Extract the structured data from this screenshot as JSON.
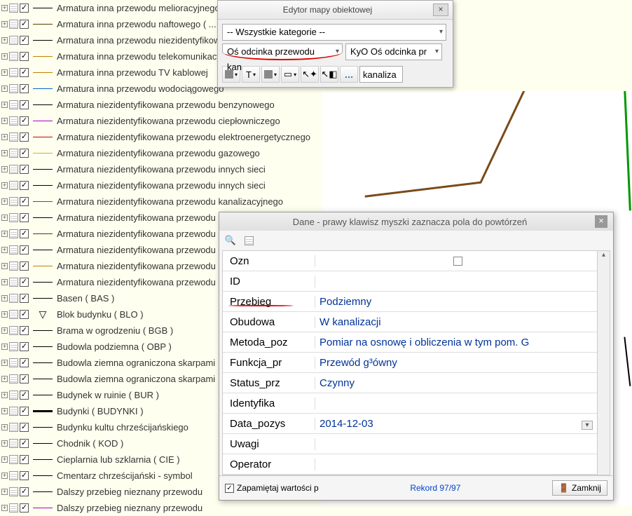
{
  "tree": {
    "items": [
      {
        "label": "Armatura inna przewodu melioracyjnego ( ... )",
        "color": "#000"
      },
      {
        "label": "Armatura inna przewodu naftowego ( ... )",
        "color": "#5a3a00"
      },
      {
        "label": "Armatura inna przewodu niezidentyfikowanego",
        "color": "#000"
      },
      {
        "label": "Armatura inna przewodu telekomunikacyjnego",
        "color": "#c08000"
      },
      {
        "label": "Armatura inna przewodu TV kablowej",
        "color": "#c08000"
      },
      {
        "label": "Armatura inna przewodu wodociągowego",
        "color": "#0066cc"
      },
      {
        "label": "Armatura niezidentyfikowana przewodu benzynowego",
        "color": "#000"
      },
      {
        "label": "Armatura niezidentyfikowana przewodu ciepłowniczego",
        "color": "#aa00cc"
      },
      {
        "label": "Armatura niezidentyfikowana przewodu elektroenergetycznego",
        "color": "#cc0000"
      },
      {
        "label": "Armatura niezidentyfikowana przewodu gazowego",
        "color": "#ccbb00"
      },
      {
        "label": "Armatura niezidentyfikowana przewodu innych sieci",
        "color": "#000"
      },
      {
        "label": "Armatura niezidentyfikowana przewodu innych sieci",
        "color": "#000"
      },
      {
        "label": "Armatura niezidentyfikowana przewodu kanalizacyjnego",
        "color": "#7a4a1a"
      },
      {
        "label": "Armatura niezidentyfikowana przewodu melioracyjnego",
        "color": "#000"
      },
      {
        "label": "Armatura niezidentyfikowana przewodu",
        "color": "#5a3a00"
      },
      {
        "label": "Armatura niezidentyfikowana przewodu",
        "color": "#000"
      },
      {
        "label": "Armatura niezidentyfikowana przewodu",
        "color": "#c08000"
      },
      {
        "label": "Armatura niezidentyfikowana przewodu",
        "color": "#000"
      },
      {
        "label": "Basen ( BAS )",
        "color": "#000"
      },
      {
        "label": "Blok budynku ( BLO )",
        "symbol": "▽"
      },
      {
        "label": "Brama w ogrodzeniu ( BGB )",
        "color": "#000"
      },
      {
        "label": "Budowla podziemna ( OBP )",
        "color": "#000"
      },
      {
        "label": "Budowla ziemna ograniczona skarpami",
        "color": "#000"
      },
      {
        "label": "Budowla ziemna ograniczona skarpami",
        "color": "#000"
      },
      {
        "label": "Budynek w ruinie ( BUR )",
        "color": "#000"
      },
      {
        "label": "Budynki ( BUDYNKI )",
        "color": "#000",
        "thick": true
      },
      {
        "label": "Budynku kultu chrześcijańskiego",
        "color": "#000"
      },
      {
        "label": "Chodnik ( KOD )",
        "color": "#000"
      },
      {
        "label": "Cieplarnia lub szklarnia ( CIE )",
        "color": "#000"
      },
      {
        "label": "Cmentarz chrześcijański - symbol",
        "color": "#000"
      },
      {
        "label": "Dalszy przebieg nieznany przewodu",
        "color": "#000"
      },
      {
        "label": "Dalszy przebieg nieznany przewodu",
        "color": "#aa00cc"
      }
    ]
  },
  "editor": {
    "title": "Edytor mapy obiektowej",
    "category": "-- Wszystkie kategorie --",
    "combo1": "Oś odcinka przewodu kan",
    "combo2": "KyO Oś odcinka pr",
    "filter": "kanaliza"
  },
  "data_panel": {
    "title": "Dane - prawy klawisz myszki zaznacza pola do powtórzeń",
    "rows": [
      {
        "label": "Ozn",
        "value": "",
        "checkbox": true
      },
      {
        "label": "ID",
        "value": ""
      },
      {
        "label": "Przebieg",
        "value": "Podziemny",
        "red": true
      },
      {
        "label": "Obudowa",
        "value": "W kanalizacji"
      },
      {
        "label": "Metoda_poz",
        "value": "Pomiar na osnowę i obliczenia w tym pom. G"
      },
      {
        "label": "Funkcja_pr",
        "value": "Przewód g³ówny"
      },
      {
        "label": "Status_prz",
        "value": "Czynny"
      },
      {
        "label": "Identyfika",
        "value": ""
      },
      {
        "label": "Data_pozys",
        "value": "2014-12-03",
        "dd": true
      },
      {
        "label": "Uwagi",
        "value": ""
      },
      {
        "label": "Operator",
        "value": ""
      }
    ],
    "remember": "Zapamiętaj wartości p",
    "rekord": "Rekord 97/97",
    "zamknij": "Zamknij"
  }
}
